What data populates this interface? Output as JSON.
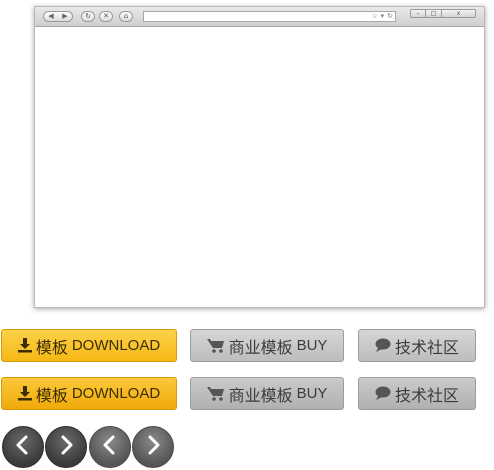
{
  "browser": {
    "nav": {
      "back": "◀",
      "forward": "▶"
    },
    "buttons": {
      "reload": "↻",
      "stop": "✕",
      "home": "⌂"
    },
    "url_icons": {
      "star": "☆",
      "dropdown": "▾",
      "refresh": "↻"
    },
    "window": {
      "minimize": "–",
      "maximize": "□",
      "close": "x"
    }
  },
  "buttons": {
    "row1": {
      "template_download": {
        "cn": "模板",
        "en": "DOWNLOAD",
        "icon": "download-icon"
      },
      "commercial_buy": {
        "cn": "商业模板",
        "en": "BUY",
        "icon": "cart-icon"
      },
      "community": {
        "cn": "技术社区",
        "icon": "chat-bubble-icon"
      }
    },
    "row2": {
      "template_download": {
        "cn": "模板",
        "en": "DOWNLOAD",
        "icon": "download-icon"
      },
      "commercial_buy": {
        "cn": "商业模板",
        "en": "BUY",
        "icon": "cart-icon"
      },
      "community": {
        "cn": "技术社区",
        "icon": "chat-bubble-icon"
      }
    }
  },
  "arrows": [
    "chevron-left-icon",
    "chevron-right-icon",
    "chevron-left-icon",
    "chevron-right-icon"
  ],
  "colors": {
    "yellow": "#f6b715",
    "gray": "#c8c8c8",
    "arrow": "#454545"
  }
}
